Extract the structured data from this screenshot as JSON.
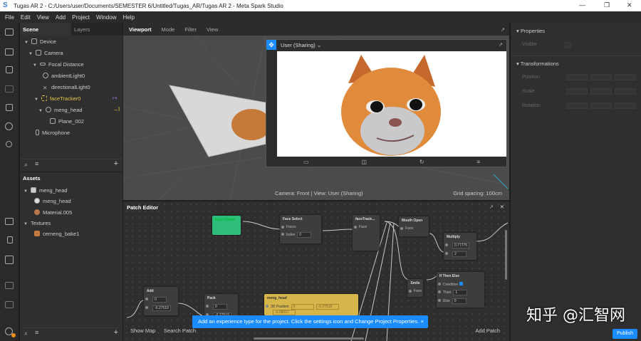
{
  "window": {
    "title": "Tugas AR 2 - C:/Users/user/Documents/SEMESTER 6/Untitled/Tugas_AR/Tugas AR 2 - Meta Spark Studio",
    "logo": "S"
  },
  "menu": [
    "File",
    "Edit",
    "View",
    "Add",
    "Project",
    "Window",
    "Help"
  ],
  "scene": {
    "tabs": [
      "Scene",
      "Layers"
    ],
    "tree": [
      {
        "label": "Device",
        "icon": "device-icon"
      },
      {
        "label": "Camera",
        "icon": "camera-icon"
      },
      {
        "label": "Focal Distance",
        "icon": "focal-icon"
      },
      {
        "label": "ambientLight0",
        "icon": "light-icon"
      },
      {
        "label": "directionalLight0",
        "icon": "directional-light-icon"
      },
      {
        "label": "faceTracker0",
        "icon": "face-tracker-icon"
      },
      {
        "label": "meng_head",
        "icon": "object-icon"
      },
      {
        "label": "Plane_002",
        "icon": "mesh-icon"
      },
      {
        "label": "Microphone",
        "icon": "microphone-icon"
      }
    ]
  },
  "assets": {
    "title": "Assets",
    "items": [
      {
        "label": "meng_head"
      },
      {
        "label": "meng_head"
      },
      {
        "label": "Material.005"
      },
      {
        "label": "Textures"
      },
      {
        "label": "cemeng_bake1"
      }
    ]
  },
  "viewport": {
    "tabs": [
      "Viewport",
      "Mode",
      "Filter",
      "View"
    ],
    "preview_label": "User (Sharing)",
    "camera_info": "Camera: Front | View: User (Sharing)",
    "grid_spacing": "Grid spacing: 100cm"
  },
  "patch": {
    "title": "Patch Editor",
    "show_map": "Show Map",
    "search_patch": "Search Patch",
    "add_patch": "Add Patch",
    "banner": "Add an experience type for the project. Click the settings icon and Change Project Properties.",
    "banner_close": "×",
    "nodes": {
      "face_finder": "Face Finder",
      "face_select": {
        "title": "Face Select",
        "faces": "Faces",
        "index": "Index",
        "index_value": "0"
      },
      "face_tracker": {
        "title": "faceTrack...",
        "face": "Face"
      },
      "mouth_open": {
        "title": "Mouth Open",
        "face": "Face"
      },
      "multiply": {
        "title": "Multiply",
        "a": "0.77775",
        "b": "2"
      },
      "smile": {
        "title": "Smile",
        "face": "Face"
      },
      "if_then_else": {
        "title": "If Then Else",
        "condition": "Condition",
        "then": "Then",
        "then_value": "1",
        "else": "Else",
        "else_value": "0"
      },
      "add": {
        "title": "Add",
        "a": "0",
        "b": "-0.27519"
      },
      "pack": {
        "title": "Pack",
        "a": "0",
        "b": "-0.27519"
      },
      "meng_head": {
        "title": "meng_head",
        "port": "3D Position",
        "x": "0",
        "y": "-0.27519",
        "z": "-0.08007"
      }
    }
  },
  "properties": {
    "title": "Properties",
    "visible": "Visible",
    "transformations": "Transformations",
    "position": "Position",
    "scale": "Scale",
    "rotation": "Rotation"
  },
  "publish": "Publish",
  "watermark": "知乎 @汇智网",
  "colors": {
    "accent": "#1a8cff",
    "face_finder": "#2ebd7a",
    "meng_head_node": "#d6b54a",
    "selected": "#e8c547"
  }
}
